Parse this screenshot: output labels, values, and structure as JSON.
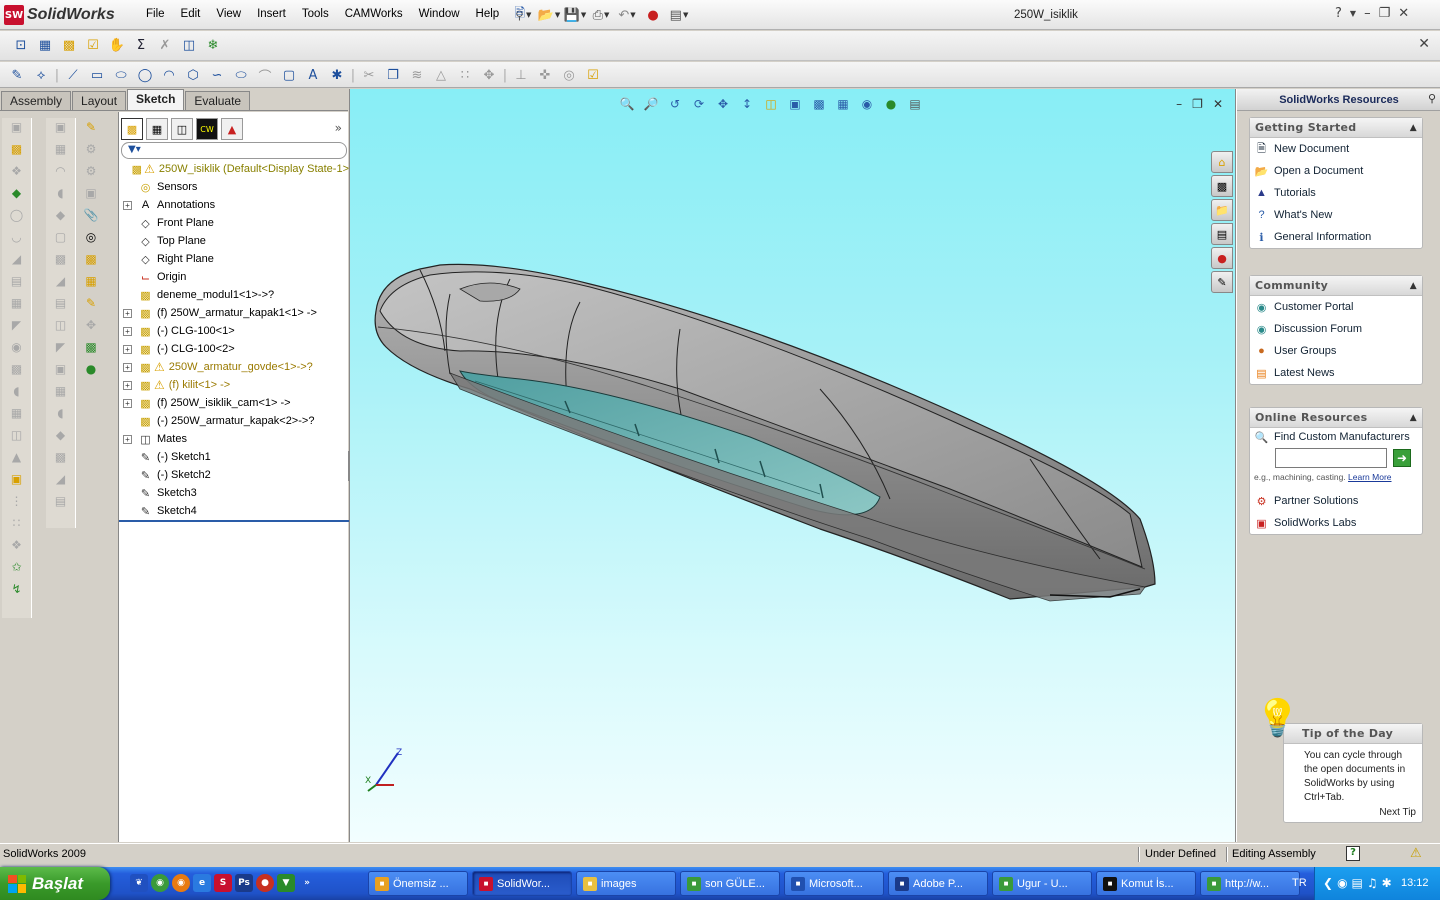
{
  "app": {
    "name": "SolidWorks",
    "logo_text": "SW",
    "document_title": "250W_isiklik"
  },
  "menu": [
    "File",
    "Edit",
    "View",
    "Insert",
    "Tools",
    "CAMWorks",
    "Window",
    "Help"
  ],
  "command_tabs": [
    {
      "label": "Assembly",
      "active": false
    },
    {
      "label": "Layout",
      "active": false
    },
    {
      "label": "Sketch",
      "active": true
    },
    {
      "label": "Evaluate",
      "active": false
    }
  ],
  "feature_tree": {
    "root": {
      "label": "250W_isiklik  (Default<Display State-1>",
      "warning": true
    },
    "items": [
      {
        "label": "Sensors",
        "icon": "sensors-icon",
        "expand": false,
        "warning": false,
        "style": "normal"
      },
      {
        "label": "Annotations",
        "icon": "annotations-icon",
        "expand": true,
        "warning": false,
        "style": "normal"
      },
      {
        "label": "Front Plane",
        "icon": "plane-icon",
        "expand": false,
        "warning": false,
        "style": "normal"
      },
      {
        "label": "Top Plane",
        "icon": "plane-icon",
        "expand": false,
        "warning": false,
        "style": "normal"
      },
      {
        "label": "Right Plane",
        "icon": "plane-icon",
        "expand": false,
        "warning": false,
        "style": "normal"
      },
      {
        "label": "Origin",
        "icon": "origin-icon",
        "expand": false,
        "warning": false,
        "style": "normal"
      },
      {
        "label": "deneme_modul1<1>->?",
        "icon": "part-icon",
        "expand": false,
        "warning": false,
        "style": "normal"
      },
      {
        "label": "(f) 250W_armatur_kapak1<1> ->",
        "icon": "part-icon",
        "expand": true,
        "warning": false,
        "style": "normal"
      },
      {
        "label": "(-) CLG-100<1>",
        "icon": "part-icon",
        "expand": true,
        "warning": false,
        "style": "normal"
      },
      {
        "label": "(-) CLG-100<2>",
        "icon": "part-icon",
        "expand": true,
        "warning": false,
        "style": "normal"
      },
      {
        "label": "250W_armatur_govde<1>->?",
        "icon": "part-icon",
        "expand": true,
        "warning": true,
        "style": "yellow"
      },
      {
        "label": "(f) kilit<1> ->",
        "icon": "part-icon",
        "expand": true,
        "warning": true,
        "style": "yellow"
      },
      {
        "label": "(f) 250W_isiklik_cam<1> ->",
        "icon": "part-icon",
        "expand": true,
        "warning": false,
        "style": "normal"
      },
      {
        "label": "(-) 250W_armatur_kapak<2>->?",
        "icon": "part-icon",
        "expand": false,
        "warning": false,
        "style": "normal"
      },
      {
        "label": "Mates",
        "icon": "mates-icon",
        "expand": true,
        "warning": false,
        "style": "normal"
      },
      {
        "label": "(-) Sketch1",
        "icon": "sketch-icon",
        "expand": false,
        "warning": false,
        "style": "normal"
      },
      {
        "label": "(-) Sketch2",
        "icon": "sketch-icon",
        "expand": false,
        "warning": false,
        "style": "normal"
      },
      {
        "label": "Sketch3",
        "icon": "sketch-icon",
        "expand": false,
        "warning": false,
        "style": "normal"
      },
      {
        "label": "Sketch4",
        "icon": "sketch-icon",
        "expand": false,
        "warning": false,
        "style": "normal"
      }
    ]
  },
  "viewport": {
    "triad_labels": {
      "y": "Y",
      "z": "Z",
      "x": "X"
    },
    "background_top": "#88eef6",
    "background_bottom": "#f2feff"
  },
  "task_pane": {
    "title": "SolidWorks Resources",
    "getting_started": {
      "title": "Getting Started",
      "items": [
        "New Document",
        "Open a Document",
        "Tutorials",
        "What's New",
        "General Information"
      ]
    },
    "community": {
      "title": "Community",
      "items": [
        "Customer Portal",
        "Discussion Forum",
        "User Groups",
        "Latest News"
      ]
    },
    "online_resources": {
      "title": "Online Resources",
      "find_label": "Find Custom Manufacturers",
      "search_value": "",
      "hint": "e.g., machining, casting.",
      "learn_more": "Learn More",
      "items": [
        "Partner Solutions",
        "SolidWorks Labs"
      ]
    },
    "tip": {
      "title": "Tip of the Day",
      "body": "You can cycle through the open documents in SolidWorks by using Ctrl+Tab.",
      "next": "Next Tip"
    }
  },
  "status_bar": {
    "version": "SolidWorks 2009",
    "sketch_state": "Under Defined",
    "mode": "Editing Assembly"
  },
  "taskbar": {
    "start_label": "Başlat",
    "tasks": [
      {
        "label": "Önemsiz ...",
        "icon_color": "#e8a020",
        "active": false
      },
      {
        "label": "SolidWor...",
        "icon_color": "#c8102e",
        "active": true
      },
      {
        "label": "images",
        "icon_color": "#e8c040",
        "active": false
      },
      {
        "label": "son GÜLE...",
        "icon_color": "#3a9a3a",
        "active": false
      },
      {
        "label": "Microsoft...",
        "icon_color": "#2050b0",
        "active": false
      },
      {
        "label": "Adobe P...",
        "icon_color": "#1a3a8a",
        "active": false
      },
      {
        "label": "Ugur - U...",
        "icon_color": "#3a9a3a",
        "active": false
      },
      {
        "label": "Komut İs...",
        "icon_color": "#111111",
        "active": false
      },
      {
        "label": "http://w...",
        "icon_color": "#3a9a3a",
        "active": false
      }
    ],
    "language": "TR",
    "clock": "13:12"
  },
  "colors": {
    "model_gray": "#8e8e8e",
    "glass_teal": "#5fa9a9",
    "accent_blue": "#2a5ca8"
  }
}
